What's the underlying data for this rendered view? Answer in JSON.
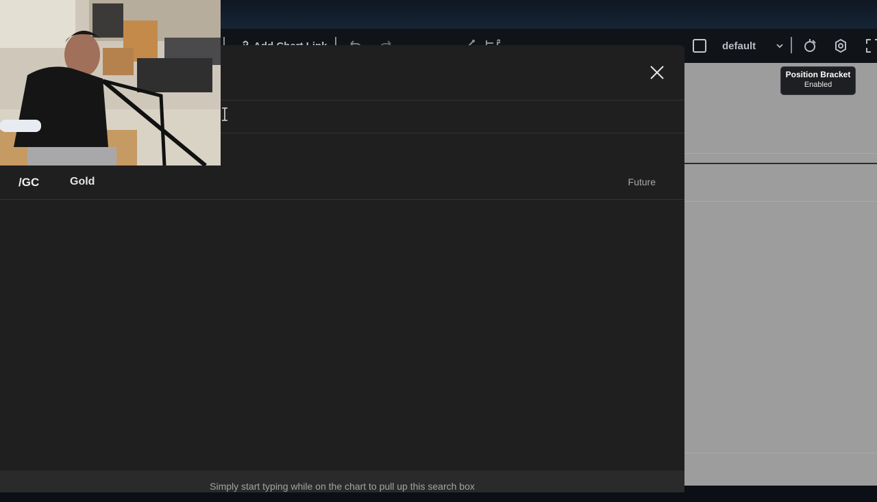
{
  "toolbar": {
    "chart_link_label": "Add Chart Link",
    "layout_name": "default"
  },
  "tooltip": {
    "title": "Position Bracket",
    "status": "Enabled"
  },
  "search": {
    "value": "",
    "placeholder": ""
  },
  "results": [
    {
      "symbol": "/GC",
      "description": "Gold",
      "type": "Future"
    }
  ],
  "footer_hint": "Simply start typing while on the chart to pull up this search box",
  "icons": {
    "close": "close-icon",
    "undo": "undo-icon",
    "redo": "redo-icon",
    "link": "link-icon",
    "layout": "layout-square-icon",
    "settings": "settings-icon",
    "fullscreen": "fullscreen-icon"
  },
  "colors": {
    "modal_bg": "#1f1f1f",
    "footer_bg": "#2a2a2a",
    "chart_bg": "#9d9d9d",
    "tooltip_bg": "#1e1f22"
  }
}
